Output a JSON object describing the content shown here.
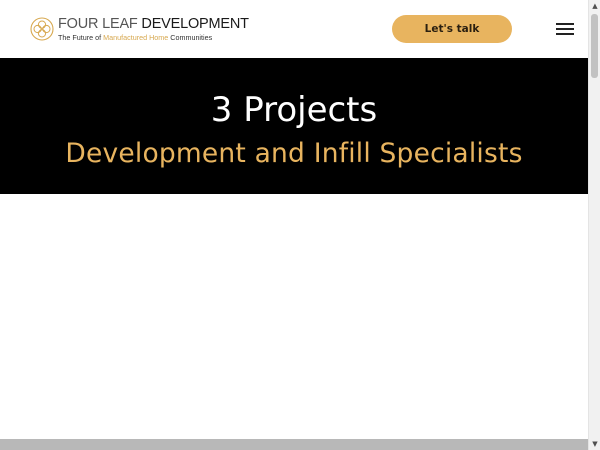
{
  "header": {
    "logo": {
      "name_part1": "FOUR LEAF",
      "name_part2": "DEVELOPMENT",
      "tagline_start": "The Future of ",
      "tagline_highlight": "Manufactured Home",
      "tagline_end": " Communities"
    },
    "cta_label": "Let's talk",
    "menu_icon": "hamburger-menu-icon"
  },
  "hero": {
    "title": "3 Projects",
    "subtitle": "Development and Infill Specialists"
  },
  "scrollbar": {
    "up_arrow": "▲",
    "down_arrow": "▼"
  },
  "colors": {
    "accent": "#e8b45f",
    "hero_background": "#000000",
    "logo_gold": "#d7a84f"
  }
}
